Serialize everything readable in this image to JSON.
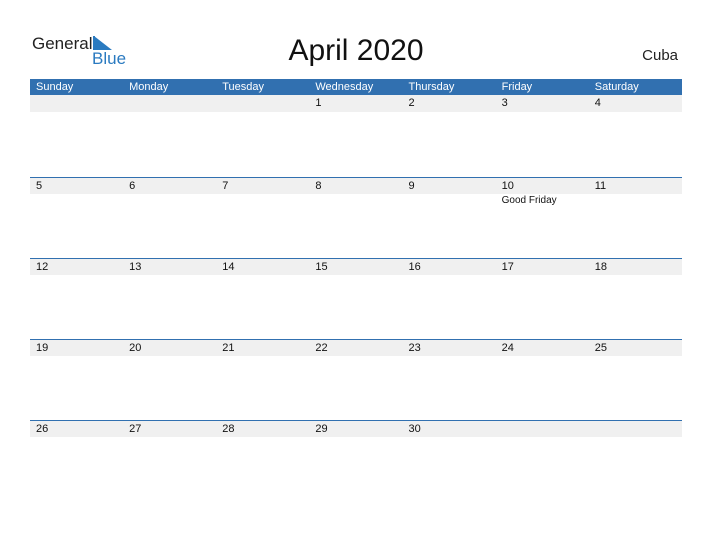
{
  "logo": {
    "general": "General",
    "blue": "Blue"
  },
  "title": "April 2020",
  "country": "Cuba",
  "weekdays": [
    "Sunday",
    "Monday",
    "Tuesday",
    "Wednesday",
    "Thursday",
    "Friday",
    "Saturday"
  ],
  "weeks": [
    {
      "dates": [
        "",
        "",
        "",
        "1",
        "2",
        "3",
        "4"
      ],
      "events": [
        "",
        "",
        "",
        "",
        "",
        "",
        ""
      ]
    },
    {
      "dates": [
        "5",
        "6",
        "7",
        "8",
        "9",
        "10",
        "11"
      ],
      "events": [
        "",
        "",
        "",
        "",
        "",
        "Good Friday",
        ""
      ]
    },
    {
      "dates": [
        "12",
        "13",
        "14",
        "15",
        "16",
        "17",
        "18"
      ],
      "events": [
        "",
        "",
        "",
        "",
        "",
        "",
        ""
      ]
    },
    {
      "dates": [
        "19",
        "20",
        "21",
        "22",
        "23",
        "24",
        "25"
      ],
      "events": [
        "",
        "",
        "",
        "",
        "",
        "",
        ""
      ]
    },
    {
      "dates": [
        "26",
        "27",
        "28",
        "29",
        "30",
        "",
        ""
      ],
      "events": [
        "",
        "",
        "",
        "",
        "",
        "",
        ""
      ]
    }
  ],
  "colors": {
    "header": "#3170b0",
    "brand": "#2a7ac0",
    "date_bar": "#f0f0f0"
  }
}
